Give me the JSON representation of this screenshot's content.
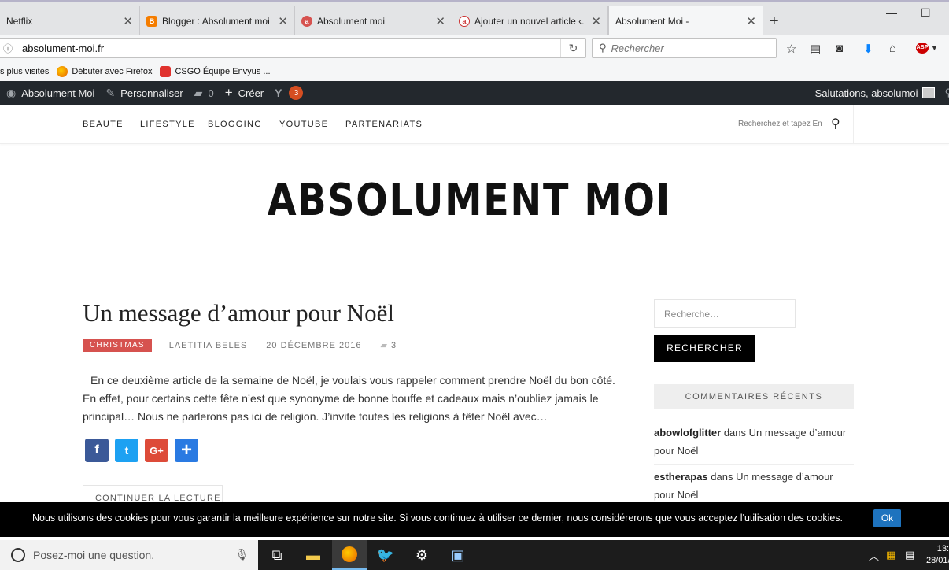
{
  "browser": {
    "tabs": [
      {
        "label": "Netflix"
      },
      {
        "label": "Blogger : Absolument moi -"
      },
      {
        "label": "Absolument moi"
      },
      {
        "label": "Ajouter un nouvel article ‹..."
      },
      {
        "label": "Absolument Moi -"
      }
    ],
    "url": "absolument-moi.fr",
    "search_placeholder": "Rechercher",
    "bookmarks": [
      "s plus visités",
      "Débuter avec Firefox",
      "CSGO Équipe Envyus ..."
    ]
  },
  "adminbar": {
    "site": "Absolument Moi",
    "customize": "Personnaliser",
    "comments_count": "0",
    "create": "Créer",
    "notifications": "3",
    "greeting": "Salutations, absolumoi"
  },
  "site": {
    "menu": [
      "BEAUTE",
      "LIFESTYLE",
      "BLOGGING",
      "YOUTUBE",
      "PARTENARIATS"
    ],
    "search_placeholder": "Recherchez et tapez En",
    "title": "ABSOLUMENT MOI"
  },
  "post": {
    "title": "Un message d’amour pour Noël",
    "category": "CHRISTMAS",
    "author": "LAETITIA BELES",
    "date": "20 DÉCEMBRE 2016",
    "comments": "3",
    "excerpt": "En ce deuxième article de la semaine de Noël, je voulais vous rappeler comment prendre Noël du bon côté. En effet, pour certains cette fête n’est que synonyme de bonne bouffe et cadeaux mais n’oubliez jamais le principal…     Nous ne parlerons pas ici de religion. J’invite toutes les religions à fêter Noël avec…",
    "read_more": "CONTINUER LA LECTURE"
  },
  "sidebar": {
    "search_placeholder": "Recherche…",
    "search_button": "RECHERCHER",
    "widget_title": "COMMENTAIRES RÉCENTS",
    "recent_comments": [
      {
        "author": "abowlofglitter",
        "text": " dans Un message d’amour pour Noël"
      },
      {
        "author": "estherapas",
        "text": " dans Un message d’amour pour Noël"
      }
    ]
  },
  "cookie": {
    "text": "Nous utilisons des cookies pour vous garantir la meilleure expérience sur notre site. Si vous continuez à utiliser ce dernier, nous considérerons que vous acceptez l'utilisation des cookies.",
    "ok": "Ok"
  },
  "taskbar": {
    "cortana_placeholder": "Posez-moi une question.",
    "time": "13:",
    "date": "28/01/"
  },
  "colors": {
    "admin_bg": "#23282d",
    "category_red": "#d6524f",
    "cookie_ok_blue": "#1e73be"
  }
}
